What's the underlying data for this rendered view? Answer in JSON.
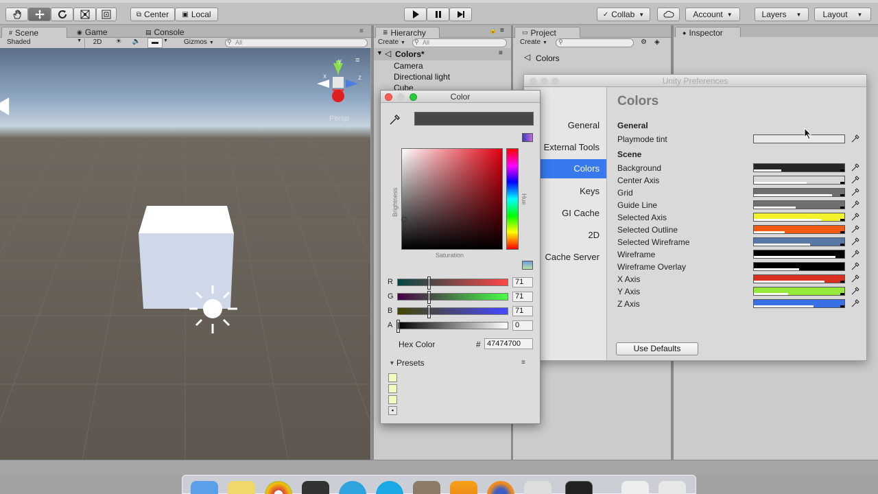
{
  "toolbar": {
    "pivot_center": "Center",
    "pivot_local": "Local",
    "collab": "Collab",
    "account": "Account",
    "layers": "Layers",
    "layout": "Layout"
  },
  "scene_panel": {
    "tabs": [
      {
        "label": "Scene"
      },
      {
        "label": "Game"
      },
      {
        "label": "Console"
      }
    ],
    "shading_mode": "Shaded",
    "mode_2d": "2D",
    "gizmos": "Gizmos",
    "search_placeholder": "All",
    "persp_label": "Persp",
    "gizmo_axes": {
      "y": "y",
      "x": "x",
      "z": "z"
    }
  },
  "hierarchy": {
    "tab": "Hierarchy",
    "create": "Create",
    "search_placeholder": "All",
    "scene_name": "Colors*",
    "items": [
      {
        "label": "Camera"
      },
      {
        "label": "Directional light"
      },
      {
        "label": "Cube"
      }
    ]
  },
  "project": {
    "tab": "Project",
    "create": "Create",
    "item": "Colors"
  },
  "inspector": {
    "tab": "Inspector"
  },
  "color_window": {
    "title": "Color",
    "brightness_label": "Brightness",
    "saturation_label": "Saturation",
    "hue_label": "Hue",
    "channels": [
      {
        "label": "R",
        "value": "71"
      },
      {
        "label": "G",
        "value": "71"
      },
      {
        "label": "B",
        "value": "71"
      },
      {
        "label": "A",
        "value": "0"
      }
    ],
    "hex_label": "Hex Color",
    "hash": "#",
    "hex_value": "47474700",
    "presets_label": "Presets",
    "current_color": "#474747"
  },
  "preferences": {
    "window_title": "Unity Preferences",
    "sidebar": [
      {
        "label": "General"
      },
      {
        "label": "External Tools"
      },
      {
        "label": "Colors"
      },
      {
        "label": "Keys"
      },
      {
        "label": "GI Cache"
      },
      {
        "label": "2D"
      },
      {
        "label": "Cache Server"
      }
    ],
    "heading": "Colors",
    "section_general": "General",
    "section_scene": "Scene",
    "general_rows": [
      {
        "label": "Playmode tint",
        "color": "#e9e9e9"
      }
    ],
    "scene_rows": [
      {
        "label": "Background",
        "color": "#262626"
      },
      {
        "label": "Center Axis",
        "color": "#d8d8d8"
      },
      {
        "label": "Grid",
        "color": "#6f6f6f"
      },
      {
        "label": "Guide Line",
        "color": "#6f6f6f"
      },
      {
        "label": "Selected Axis",
        "color": "#f2f22a"
      },
      {
        "label": "Selected Outline",
        "color": "#f25a12"
      },
      {
        "label": "Selected Wireframe",
        "color": "#5878a8"
      },
      {
        "label": "Wireframe",
        "color": "#000000"
      },
      {
        "label": "Wireframe Overlay",
        "color": "#000000"
      },
      {
        "label": "X Axis",
        "color": "#d93020"
      },
      {
        "label": "Y Axis",
        "color": "#96e83a"
      },
      {
        "label": "Z Axis",
        "color": "#3a70e6"
      }
    ],
    "use_defaults": "Use Defaults"
  }
}
